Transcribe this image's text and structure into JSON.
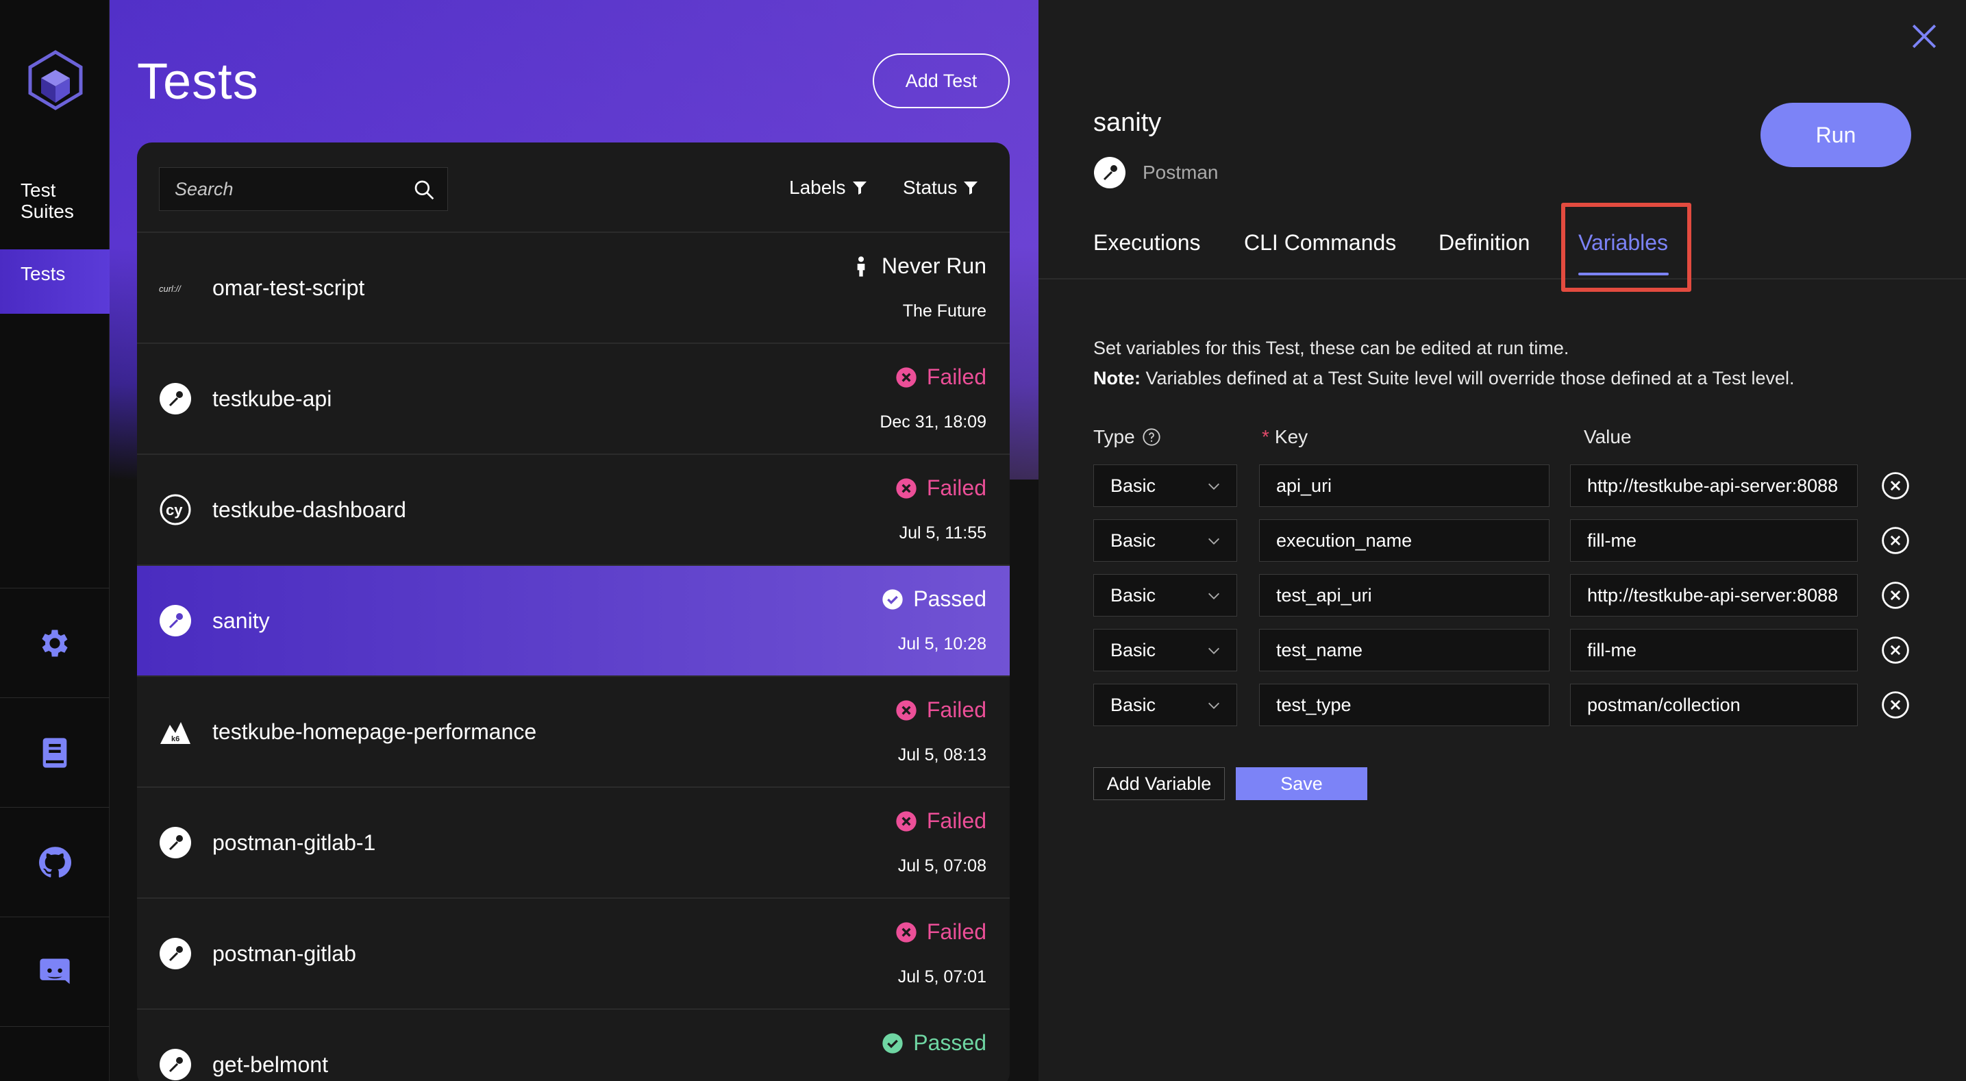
{
  "nav": {
    "items": [
      {
        "label": "Test\nSuites"
      },
      {
        "label": "Tests"
      }
    ],
    "bottom_icons": [
      "gear-icon",
      "book-icon",
      "github-icon",
      "discord-icon"
    ]
  },
  "tests_page": {
    "title": "Tests",
    "add_test_label": "Add Test",
    "search_placeholder": "Search",
    "filters": {
      "labels": "Labels",
      "status": "Status"
    },
    "rows": [
      {
        "icon": "curl-icon",
        "name": "omar-test-script",
        "status": "Never Run",
        "status_type": "never",
        "date": "The Future"
      },
      {
        "icon": "postman-icon",
        "name": "testkube-api",
        "status": "Failed",
        "status_type": "failed",
        "date": "Dec 31, 18:09"
      },
      {
        "icon": "cypress-icon",
        "name": "testkube-dashboard",
        "status": "Failed",
        "status_type": "failed",
        "date": "Jul 5, 11:55"
      },
      {
        "icon": "postman-icon",
        "name": "sanity",
        "status": "Passed",
        "status_type": "passed",
        "date": "Jul 5, 10:28"
      },
      {
        "icon": "k6-icon",
        "name": "testkube-homepage-performance",
        "status": "Failed",
        "status_type": "failed",
        "date": "Jul 5, 08:13"
      },
      {
        "icon": "postman-icon",
        "name": "postman-gitlab-1",
        "status": "Failed",
        "status_type": "failed",
        "date": "Jul 5, 07:08"
      },
      {
        "icon": "postman-icon",
        "name": "postman-gitlab",
        "status": "Failed",
        "status_type": "failed",
        "date": "Jul 5, 07:01"
      },
      {
        "icon": "postman-icon",
        "name": "get-belmont",
        "status": "Passed",
        "status_type": "passed-green",
        "date": ""
      }
    ]
  },
  "detail": {
    "title": "sanity",
    "type_label": "Postman",
    "run_label": "Run",
    "tabs": [
      "Executions",
      "CLI Commands",
      "Definition",
      "Variables"
    ],
    "active_tab": "Variables",
    "description": "Set variables for this Test, these can be edited at run time.",
    "note_label": "Note:",
    "note_text": " Variables defined at a Test Suite level will override those defined at a Test level.",
    "headers": {
      "type": "Type",
      "key_required": "*",
      "key": "Key",
      "value": "Value"
    },
    "variables": [
      {
        "type": "Basic",
        "key": "api_uri",
        "value": "http://testkube-api-server:8088"
      },
      {
        "type": "Basic",
        "key": "execution_name",
        "value": "fill-me"
      },
      {
        "type": "Basic",
        "key": "test_api_uri",
        "value": "http://testkube-api-server:8088"
      },
      {
        "type": "Basic",
        "key": "test_name",
        "value": "fill-me"
      },
      {
        "type": "Basic",
        "key": "test_type",
        "value": "postman/collection"
      }
    ],
    "add_variable_label": "Add Variable",
    "save_label": "Save"
  },
  "colors": {
    "accent": "#7c83f7",
    "failed": "#ec4f98",
    "passed_green": "#6fd6a3",
    "highlight": "#e34b3f"
  }
}
